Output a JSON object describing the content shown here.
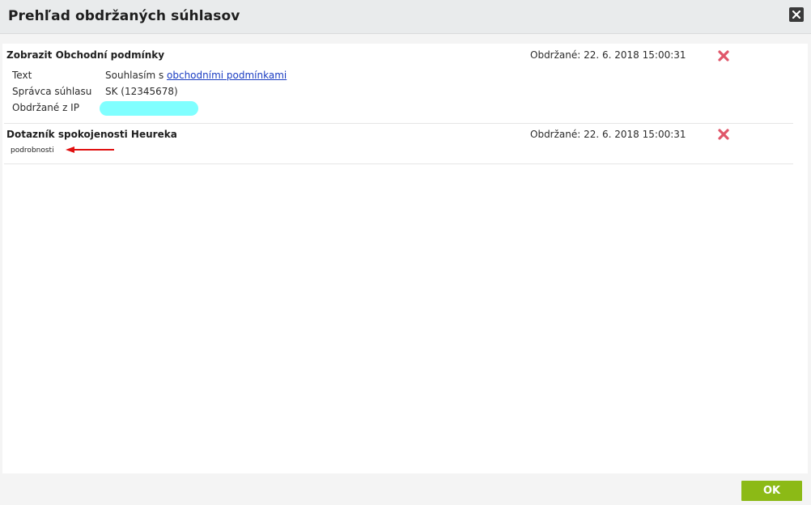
{
  "dialog": {
    "title": "Prehľad obdržaných súhlasov",
    "ok_label": "OK"
  },
  "consents": [
    {
      "title": "Zobrazit Obchodní podmínky",
      "received": "Obdržané: 22. 6. 2018 15:00:31",
      "rows": {
        "text_label": "Text",
        "text_prefix": "Souhlasím s ",
        "text_link": "obchodními podmínkami",
        "manager_label": "Správca súhlasu",
        "manager_value": "SK (12345678)",
        "ip_label": "Obdržané z IP"
      }
    },
    {
      "title": "Dotazník spokojenosti Heureka",
      "received": "Obdržané: 22. 6. 2018 15:00:31",
      "details_link": "podrobnosti"
    }
  ],
  "colors": {
    "ok_button": "#8cba16",
    "delete_icon": "#e0566a",
    "link": "#1a3cc2",
    "ip_redaction": "#80ffff",
    "annotation_arrow": "#e01010"
  },
  "icons": {
    "close": "close-icon",
    "delete": "delete-x-icon",
    "annotation": "red-arrow-annotation"
  }
}
